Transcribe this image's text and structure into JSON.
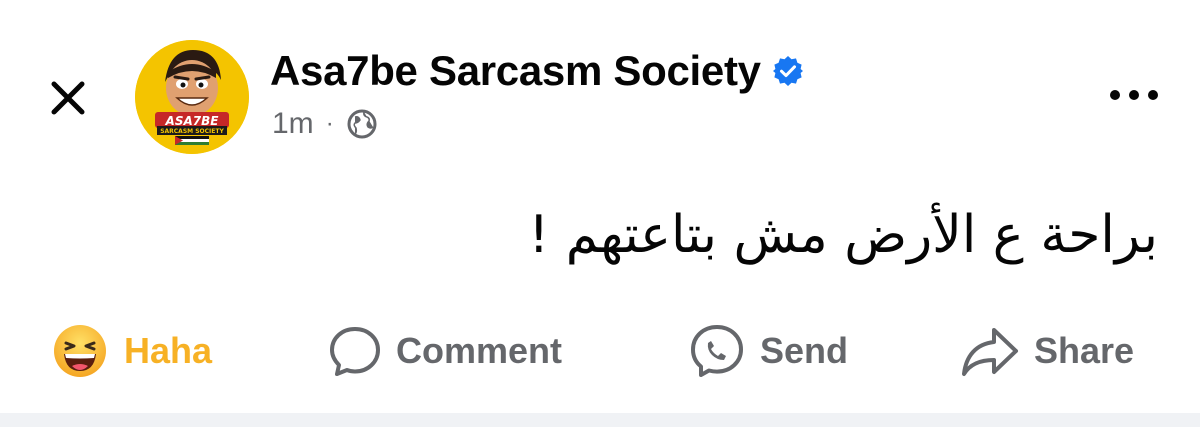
{
  "post": {
    "page_name": "Asa7be Sarcasm Society",
    "time_ago": "1m",
    "meta_separator": "·",
    "text": "براحة ع الأرض مش بتاعتهم !",
    "avatar_text_main": "ASA7BE",
    "avatar_text_sub": "SARCASM SOCIETY"
  },
  "actions": {
    "haha_label": "Haha",
    "comment_label": "Comment",
    "send_label": "Send",
    "share_label": "Share"
  },
  "colors": {
    "verified_blue": "#1877f2",
    "haha_yellow": "#f7b125",
    "muted_gray": "#65676b",
    "avatar_yellow": "#f4c400"
  },
  "icons": {
    "close": "close-icon",
    "verified": "verified-badge-icon",
    "privacy": "globe-icon",
    "more": "more-options-icon",
    "haha": "haha-reaction-icon",
    "comment": "comment-icon",
    "send": "messenger-icon",
    "share": "share-arrow-icon"
  }
}
